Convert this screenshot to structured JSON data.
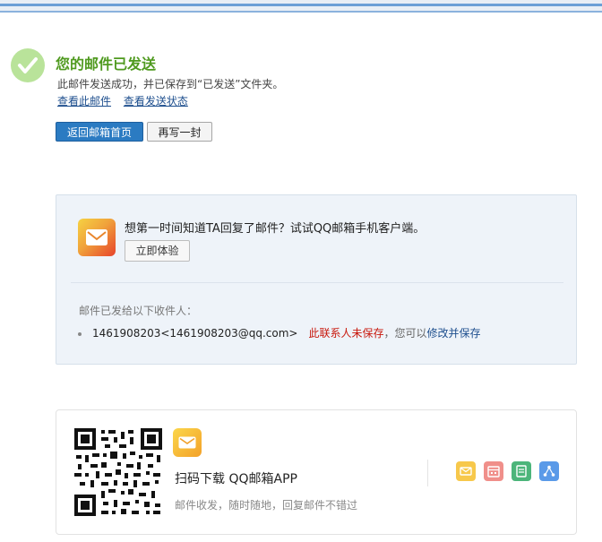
{
  "result": {
    "title": "您的邮件已发送",
    "subtitle": "此邮件发送成功，并已保存到“已发送”文件夹。",
    "view_mail_link": "查看此邮件",
    "view_status_link": "查看发送状态",
    "back_button": "返回邮箱首页",
    "write_again_button": "再写一封"
  },
  "promo_panel": {
    "promo_text": "想第一时间知道TA回复了邮件？试试QQ邮箱手机客户端。",
    "try_button": "立即体验",
    "sent_to_label": "邮件已发给以下收件人：",
    "recipient": {
      "address": "1461908203<1461908203@qq.com>",
      "unsaved_warning": "此联系人未保存",
      "hint": "，您可以",
      "save_link": "修改并保存"
    }
  },
  "app_card": {
    "download_text": "扫码下载 QQ邮箱APP",
    "tagline": "邮件收发，随时随地，回复邮件不错过",
    "feature_icons": [
      "mail-icon",
      "calendar-icon",
      "note-icon",
      "share-icon"
    ]
  },
  "colors": {
    "title_green": "#4f9a1f",
    "primary_blue": "#2b7bc2",
    "warning_red": "#c8170c",
    "link_blue": "#1e4f8e",
    "panel_bg": "#eef3f9"
  }
}
